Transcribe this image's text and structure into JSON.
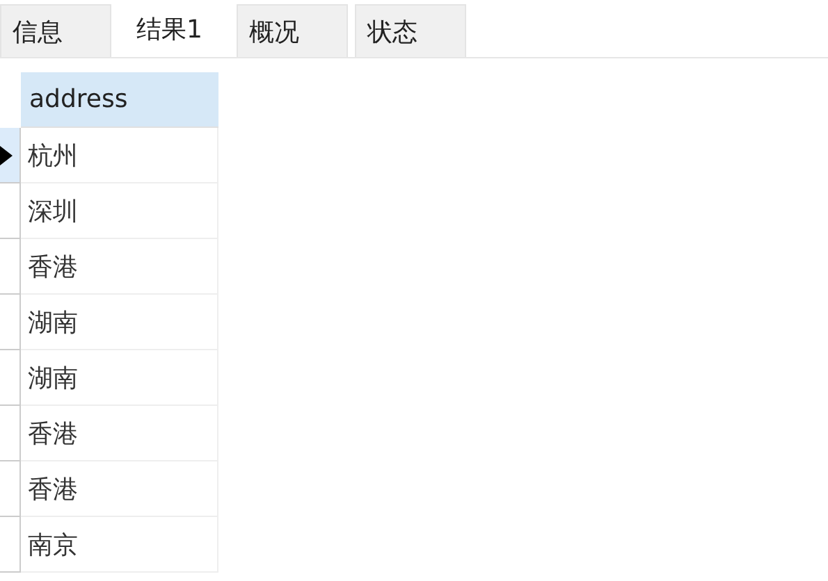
{
  "tabs": [
    {
      "label": "信息",
      "selected": false
    },
    {
      "label": "结果1",
      "selected": true
    },
    {
      "label": "概况",
      "selected": false
    },
    {
      "label": "状态",
      "selected": false
    }
  ],
  "table": {
    "columns": [
      "address"
    ],
    "rows": [
      {
        "cells": [
          "杭州"
        ],
        "selected": true
      },
      {
        "cells": [
          "深圳"
        ],
        "selected": false
      },
      {
        "cells": [
          "香港"
        ],
        "selected": false
      },
      {
        "cells": [
          "湖南"
        ],
        "selected": false
      },
      {
        "cells": [
          "湖南"
        ],
        "selected": false
      },
      {
        "cells": [
          "香港"
        ],
        "selected": false
      },
      {
        "cells": [
          "香港"
        ],
        "selected": false
      },
      {
        "cells": [
          "南京"
        ],
        "selected": false
      }
    ]
  }
}
